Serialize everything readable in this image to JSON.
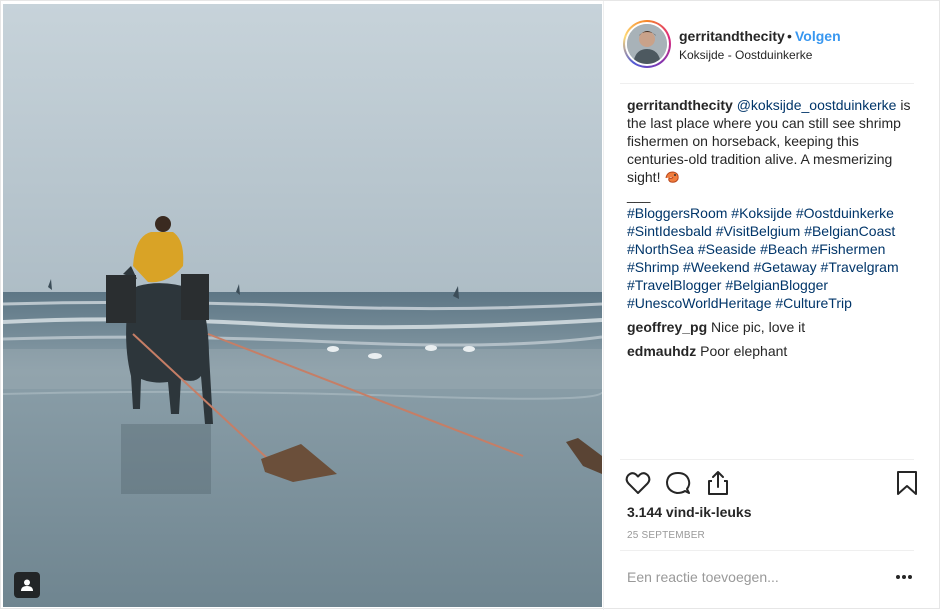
{
  "post": {
    "username": "gerritandthecity",
    "separator": "•",
    "follow_label": "Volgen",
    "location": "Koksijde - Oostduinkerke"
  },
  "caption": {
    "username": "gerritandthecity",
    "mention": "@koksijde_oostduinkerke",
    "text": " is the last place where you can still see shrimp fishermen on horseback, keeping this centuries-old tradition alive. A mesmerizing sight! ",
    "emoji": "shrimp-emoji",
    "separator_line": "___",
    "hashtags": [
      "#BloggersRoom",
      "#Koksijde",
      "#Oostduinkerke",
      "#SintIdesbald",
      "#VisitBelgium",
      "#BelgianCoast",
      "#NorthSea",
      "#Seaside",
      "#Beach",
      "#Fishermen",
      "#Shrimp",
      "#Weekend",
      "#Getaway",
      "#Travelgram",
      "#TravelBlogger",
      "#BelgianBlogger",
      "#UnescoWorldHeritage",
      "#CultureTrip"
    ]
  },
  "comments": [
    {
      "username": "geoffrey_pg",
      "text": "Nice pic, love it"
    },
    {
      "username": "edmauhdz",
      "text": "Poor elephant"
    }
  ],
  "actions": {
    "like_icon": "heart-icon",
    "comment_icon": "comment-icon",
    "share_icon": "share-icon",
    "save_icon": "bookmark-icon"
  },
  "likes_label": "3.144 vind-ik-leuks",
  "date_label": "25 SEPTEMBER",
  "add_comment_placeholder": "Een reactie toevoegen...",
  "more_icon": "more-options-icon",
  "photo_tag_icon": "user-tag-icon",
  "colors": {
    "follow": "#3897f0",
    "hashtag": "#003569",
    "muted": "#999999",
    "text": "#262626"
  }
}
